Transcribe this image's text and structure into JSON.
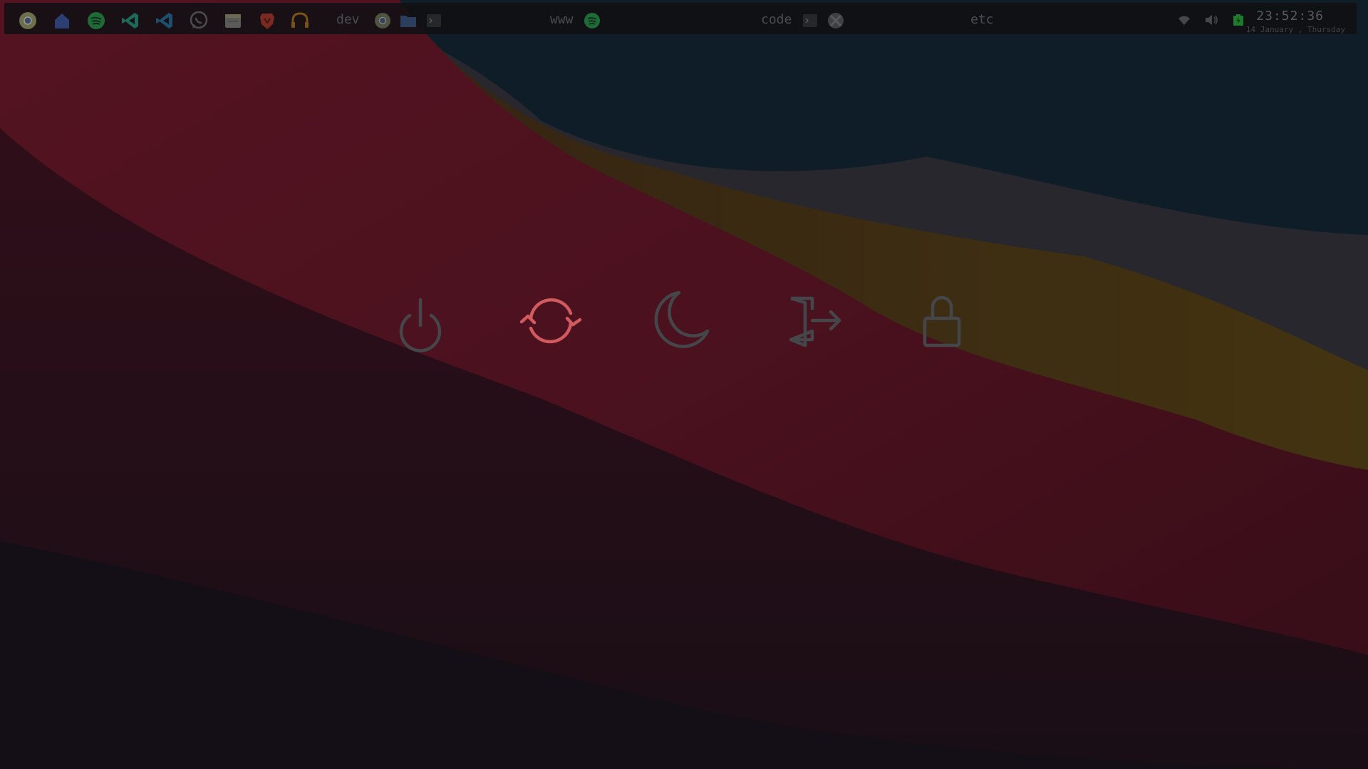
{
  "launcher": {
    "apps": [
      {
        "name": "chrome",
        "color": "#6b6f4a"
      },
      {
        "name": "files",
        "color": "#2b3f72"
      },
      {
        "name": "spotify",
        "color": "#1f6b38"
      },
      {
        "name": "vscode",
        "color": "#1e6a5a"
      },
      {
        "name": "vscode-insiders",
        "color": "#1f4f6e"
      },
      {
        "name": "whatsapp",
        "color": "#4a4d50"
      },
      {
        "name": "notes",
        "color": "#5a5a58"
      },
      {
        "name": "brave",
        "color": "#7a2a20"
      },
      {
        "name": "headset",
        "color": "#7a5212"
      }
    ]
  },
  "workspaces": [
    {
      "label": "dev",
      "icons": [
        "chrome-icon",
        "folder-icon",
        "terminal-icon"
      ]
    },
    {
      "label": "www",
      "icons": [
        "spotify-icon"
      ]
    },
    {
      "label": "code",
      "icons": [
        "terminal-icon",
        "vpn-icon"
      ]
    },
    {
      "label": "etc",
      "icons": []
    }
  ],
  "tray": {
    "wifi": "wifi-icon",
    "volume": "volume-icon",
    "battery": "battery-icon",
    "battery_color": "#1f7a2e"
  },
  "clock": {
    "time": "23:52:36",
    "date": "14 January , Thursday"
  },
  "power_menu": {
    "options": [
      {
        "name": "shutdown",
        "icon": "power-icon",
        "selected": false
      },
      {
        "name": "reboot",
        "icon": "reboot-icon",
        "selected": true
      },
      {
        "name": "suspend",
        "icon": "moon-icon",
        "selected": false
      },
      {
        "name": "logout",
        "icon": "logout-icon",
        "selected": false
      },
      {
        "name": "lock",
        "icon": "lock-icon",
        "selected": false
      }
    ],
    "colors": {
      "normal": "#45464a",
      "selected": "#d15a5e"
    }
  }
}
